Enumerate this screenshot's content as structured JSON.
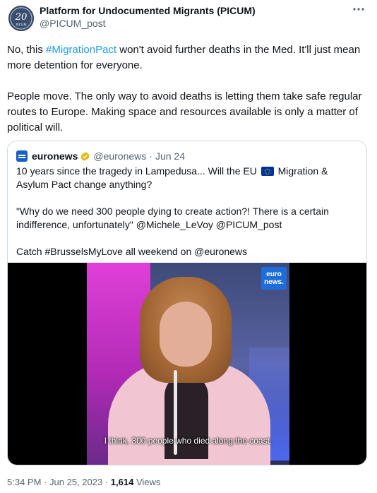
{
  "author": {
    "name": "Platform for Undocumented Migrants (PICUM)",
    "handle": "@PICUM_post",
    "avatar_icon": "picum-20-years-logo",
    "avatar_text": "20",
    "avatar_subtext": "PICUM"
  },
  "more_icon": "more-horizontal-icon",
  "tweet": {
    "p1_pre": "No, this ",
    "p1_hashtag": "#MigrationPact",
    "p1_post": " won't avoid further deaths in the Med. It'll just mean more detention for everyone.",
    "p2": "People move. The only way to avoid deaths is letting them take safe regular routes to Europe. Making space and resources available is only a matter of political will."
  },
  "quote": {
    "name": "euronews",
    "handle": "@euronews",
    "separator": "·",
    "date": "Jun 24",
    "verified_icon": "verified-gold-badge-icon",
    "line1_pre": "10 years since the tragedy in Lampedusa... Will the EU ",
    "flag_icon": "eu-flag-icon",
    "line1_post": " Migration & Asylum Pact change anything?",
    "line2": "\"Why do we need 300 people dying to create action?! There is a certain indifference, unfortunately\" @Michele_LeVoy @PICUM_post",
    "line3": "Catch #BrusselsMyLove all weekend on @euronews",
    "video": {
      "logo_line1": "euro",
      "logo_line2": "news.",
      "caption": "I think, 300 people who died along the coast."
    }
  },
  "footer": {
    "time": "5:34 PM",
    "separator1": "·",
    "date": "Jun 25, 2023",
    "separator2": "·",
    "views_count": "1,614",
    "views_label": "Views"
  },
  "colors": {
    "link": "#1d9bf0",
    "text": "#0f1419",
    "secondary": "#536471",
    "border": "#cfd9de",
    "euronews_blue": "#1f6ddb"
  }
}
